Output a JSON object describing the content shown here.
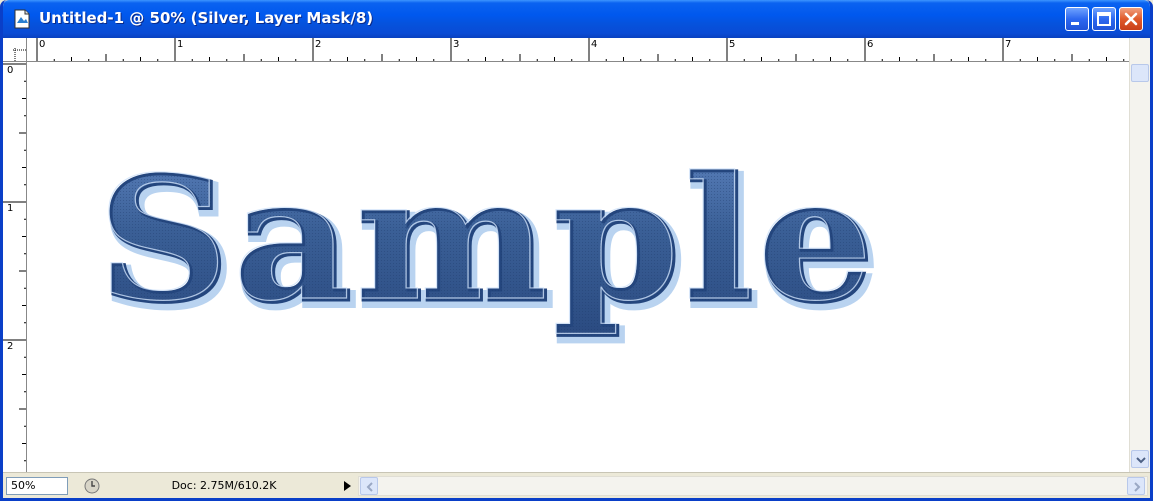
{
  "window": {
    "title": "Untitled-1 @ 50% (Silver, Layer Mask/8)",
    "buttons": {
      "minimize": "minimize-icon",
      "maximize": "maximize-icon",
      "close": "close-icon"
    }
  },
  "rulers": {
    "horizontal_labels": [
      "0",
      "1",
      "2",
      "3",
      "4",
      "5",
      "6",
      "7"
    ],
    "vertical_labels": [
      "0",
      "1",
      "2"
    ]
  },
  "canvas": {
    "text": "Sample",
    "text_color": "#3a5f96",
    "highlight_color": "#b9d3f0",
    "background": "#ffffff"
  },
  "statusbar": {
    "zoom": "50%",
    "doc_info": "Doc: 2.75M/610.2K"
  },
  "colors": {
    "titlebar_blue": "#0058ee",
    "close_red": "#e05a2a",
    "chrome": "#ece9d8"
  }
}
